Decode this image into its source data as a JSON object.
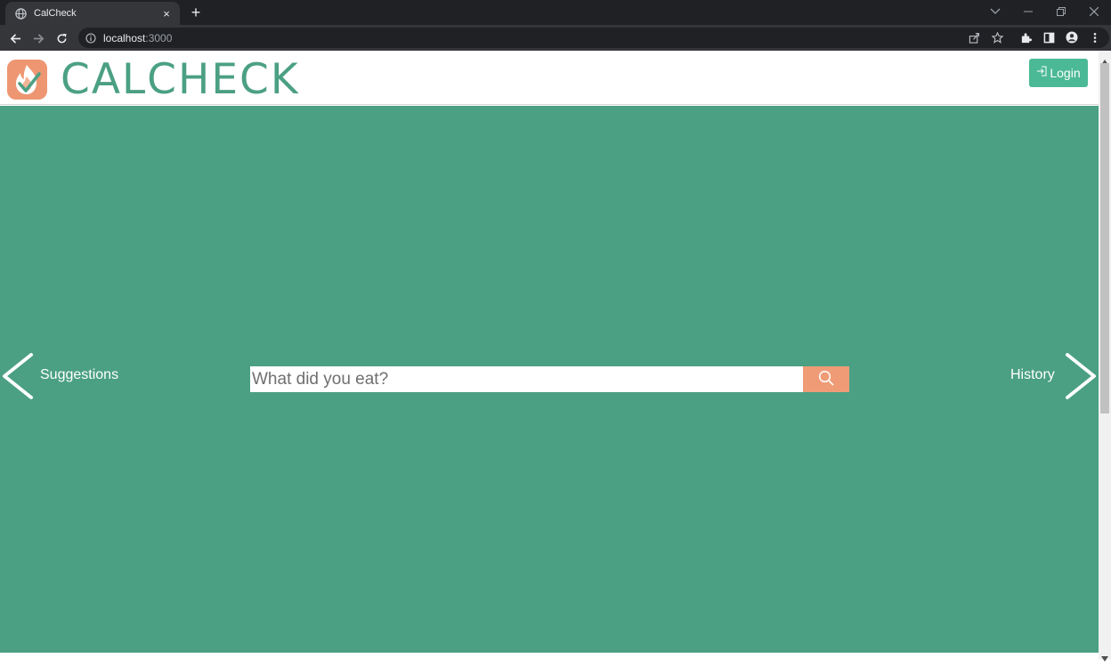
{
  "browser": {
    "tab_title": "CalCheck",
    "tab_close": "×",
    "new_tab": "+",
    "url_host": "localhost",
    "url_port": ":3000"
  },
  "header": {
    "brand": "CALCHECK",
    "login_label": "Login"
  },
  "main": {
    "left_nav_label": "Suggestions",
    "right_nav_label": "History",
    "search_placeholder": "What did you eat?"
  },
  "colors": {
    "brand_green": "#4ba084",
    "login_green": "#4bb995",
    "accent_orange": "#ef9c76"
  },
  "icons": [
    "globe-icon",
    "close-icon",
    "plus-icon",
    "back-icon",
    "forward-icon",
    "reload-icon",
    "info-icon",
    "share-icon",
    "star-icon",
    "extensions-icon",
    "side-panel-icon",
    "profile-icon",
    "menu-icon",
    "logo-icon",
    "login-icon",
    "chevron-left-icon",
    "chevron-right-icon",
    "search-icon"
  ]
}
